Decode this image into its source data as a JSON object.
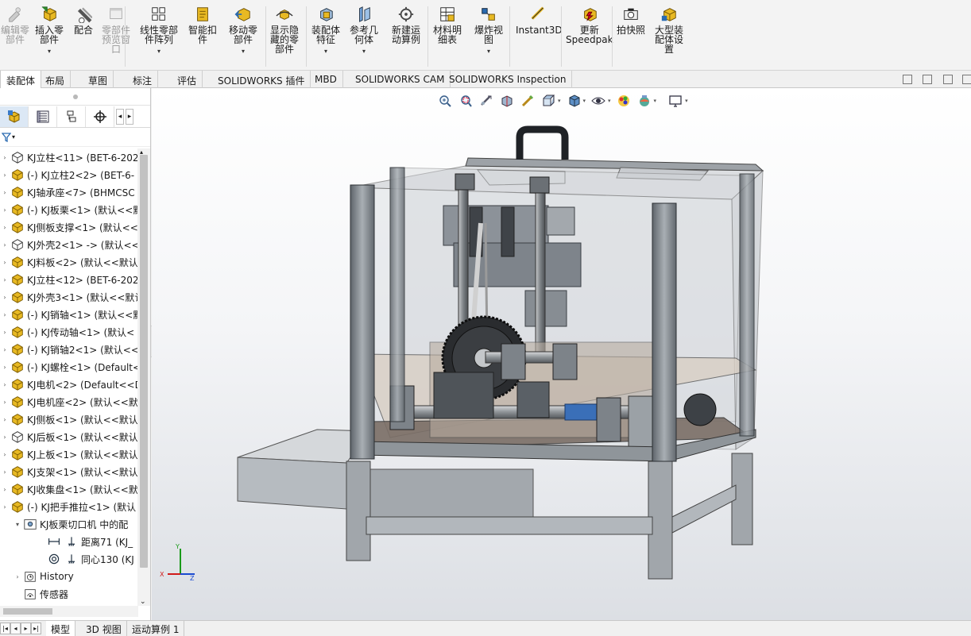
{
  "ribbon": {
    "buttons": [
      {
        "label": "编辑零\n部件",
        "icon": "edit-component-icon",
        "enabled": false,
        "dropdown": false
      },
      {
        "label": "插入零\n部件",
        "icon": "insert-components-icon",
        "enabled": true,
        "dropdown": true
      },
      {
        "label": "配合",
        "icon": "mate-icon",
        "enabled": true,
        "dropdown": false
      },
      {
        "label": "零部件\n预览窗\n口",
        "icon": "component-preview-icon",
        "enabled": false,
        "dropdown": false
      },
      {
        "label": "线性零部\n件阵列",
        "icon": "linear-pattern-icon",
        "enabled": true,
        "dropdown": true
      },
      {
        "label": "智能扣\n件",
        "icon": "smart-fasteners-icon",
        "enabled": true,
        "dropdown": false
      },
      {
        "label": "移动零\n部件",
        "icon": "move-component-icon",
        "enabled": true,
        "dropdown": true
      },
      {
        "label": "显示隐\n藏的零\n部件",
        "icon": "show-hidden-icon",
        "enabled": true,
        "dropdown": false
      },
      {
        "label": "装配体\n特征",
        "icon": "assembly-features-icon",
        "enabled": true,
        "dropdown": true
      },
      {
        "label": "参考几\n何体",
        "icon": "reference-geometry-icon",
        "enabled": true,
        "dropdown": true
      },
      {
        "label": "新建运\n动算例",
        "icon": "new-motion-study-icon",
        "enabled": true,
        "dropdown": false
      },
      {
        "label": "材料明\n细表",
        "icon": "bom-icon",
        "enabled": true,
        "dropdown": false
      },
      {
        "label": "爆炸视\n图",
        "icon": "exploded-view-icon",
        "enabled": true,
        "dropdown": true
      },
      {
        "label": "Instant3D",
        "icon": "instant3d-icon",
        "enabled": true,
        "dropdown": false
      },
      {
        "label": "更新\nSpeedpak",
        "icon": "speedpak-icon",
        "enabled": true,
        "dropdown": false
      },
      {
        "label": "拍快照",
        "icon": "snapshot-icon",
        "enabled": true,
        "dropdown": false
      },
      {
        "label": "大型装\n配体设\n置",
        "icon": "large-assembly-icon",
        "enabled": true,
        "dropdown": false
      }
    ]
  },
  "tabs": [
    {
      "label": "装配体",
      "active": true
    },
    {
      "label": "布局"
    },
    {
      "label": "草图"
    },
    {
      "label": "标注"
    },
    {
      "label": "评估"
    },
    {
      "label": "SOLIDWORKS 插件"
    },
    {
      "label": "MBD"
    },
    {
      "label": "SOLIDWORKS CAM"
    },
    {
      "label": "SOLIDWORKS Inspection"
    }
  ],
  "tree": {
    "items": [
      {
        "label": "KJ立柱<11> (BET-6-202",
        "icon": "part-outline-icon"
      },
      {
        "label": "(-) KJ立柱2<2> (BET-6-",
        "icon": "part-icon"
      },
      {
        "label": "KJ轴承座<7> (BHMCSC",
        "icon": "part-icon"
      },
      {
        "label": "(-) KJ板栗<1> (默认<<默",
        "icon": "part-icon"
      },
      {
        "label": "KJ侧板支撑<1> (默认<<",
        "icon": "part-icon"
      },
      {
        "label": "KJ外壳2<1> -> (默认<<",
        "icon": "part-outline-icon"
      },
      {
        "label": "KJ料板<2> (默认<<默认",
        "icon": "part-icon"
      },
      {
        "label": "KJ立柱<12> (BET-6-202",
        "icon": "part-icon"
      },
      {
        "label": "KJ外壳3<1> (默认<<默认",
        "icon": "part-icon"
      },
      {
        "label": "(-) KJ销轴<1> (默认<<默",
        "icon": "part-icon"
      },
      {
        "label": "(-) KJ传动轴<1> (默认<",
        "icon": "part-icon"
      },
      {
        "label": "(-) KJ销轴2<1> (默认<<",
        "icon": "part-icon"
      },
      {
        "label": "(-) KJ螺栓<1> (Default<",
        "icon": "part-icon"
      },
      {
        "label": "KJ电机<2> (Default<<D",
        "icon": "part-icon"
      },
      {
        "label": "KJ电机座<2> (默认<<默",
        "icon": "part-icon"
      },
      {
        "label": "KJ侧板<1> (默认<<默认",
        "icon": "part-icon"
      },
      {
        "label": "KJ后板<1> (默认<<默认",
        "icon": "part-outline-icon"
      },
      {
        "label": "KJ上板<1> (默认<<默认",
        "icon": "part-icon"
      },
      {
        "label": "KJ支架<1> (默认<<默认",
        "icon": "part-icon"
      },
      {
        "label": "KJ收集盘<1> (默认<<默",
        "icon": "part-icon"
      },
      {
        "label": "(-) KJ把手推拉<1> (默认",
        "icon": "part-icon"
      }
    ],
    "mates_folder": "KJ板栗切口机 中的配",
    "mates": [
      {
        "label": "距离71 (KJ_",
        "icon": "distance-mate-icon"
      },
      {
        "label": "同心130 (KJ",
        "icon": "concentric-mate-icon"
      }
    ],
    "history": "History",
    "sensors": "传感器"
  },
  "bottom_tabs": [
    {
      "label": "模型",
      "active": true
    },
    {
      "label": "3D 视图"
    },
    {
      "label": "运动算例 1"
    }
  ],
  "colors": {
    "part_yellow": "#e8b923",
    "accent_blue": "#2a6ab0",
    "frame_gray": "#8a9096"
  }
}
